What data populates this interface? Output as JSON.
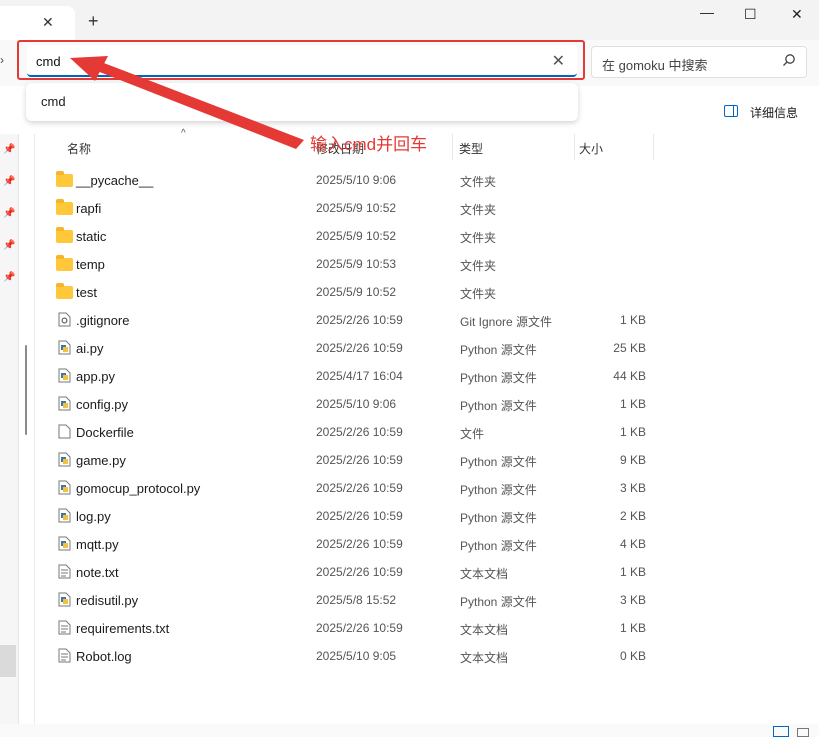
{
  "window": {
    "close_tab_glyph": "✕",
    "new_tab_glyph": "+",
    "minimize_glyph": "—",
    "maximize_glyph": "☐",
    "close_glyph": "✕"
  },
  "address": {
    "value": "cmd",
    "clear_glyph": "✕"
  },
  "search": {
    "placeholder": "在 gomoku 中搜索"
  },
  "suggestion": {
    "item": "cmd"
  },
  "toolbar": {
    "details_label": "详细信息"
  },
  "annotation": {
    "text": "输入cmd并回车",
    "color": "#e53935"
  },
  "columns": {
    "name": "名称",
    "date": "修改日期",
    "type": "类型",
    "size": "大小"
  },
  "files": [
    {
      "name": "__pycache__",
      "date": "2025/5/10 9:06",
      "type": "文件夹",
      "size": "",
      "icon": "folder-icon"
    },
    {
      "name": "rapfi",
      "date": "2025/5/9 10:52",
      "type": "文件夹",
      "size": "",
      "icon": "folder-icon"
    },
    {
      "name": "static",
      "date": "2025/5/9 10:52",
      "type": "文件夹",
      "size": "",
      "icon": "folder-icon"
    },
    {
      "name": "temp",
      "date": "2025/5/9 10:53",
      "type": "文件夹",
      "size": "",
      "icon": "folder-icon"
    },
    {
      "name": "test",
      "date": "2025/5/9 10:52",
      "type": "文件夹",
      "size": "",
      "icon": "folder-icon"
    },
    {
      "name": ".gitignore",
      "date": "2025/2/26 10:59",
      "type": "Git Ignore 源文件",
      "size": "1 KB",
      "icon": "gear-file-icon"
    },
    {
      "name": "ai.py",
      "date": "2025/2/26 10:59",
      "type": "Python 源文件",
      "size": "25 KB",
      "icon": "python-file-icon"
    },
    {
      "name": "app.py",
      "date": "2025/4/17 16:04",
      "type": "Python 源文件",
      "size": "44 KB",
      "icon": "python-file-icon"
    },
    {
      "name": "config.py",
      "date": "2025/5/10 9:06",
      "type": "Python 源文件",
      "size": "1 KB",
      "icon": "python-file-icon"
    },
    {
      "name": "Dockerfile",
      "date": "2025/2/26 10:59",
      "type": "文件",
      "size": "1 KB",
      "icon": "blank-file-icon"
    },
    {
      "name": "game.py",
      "date": "2025/2/26 10:59",
      "type": "Python 源文件",
      "size": "9 KB",
      "icon": "python-file-icon"
    },
    {
      "name": "gomocup_protocol.py",
      "date": "2025/2/26 10:59",
      "type": "Python 源文件",
      "size": "3 KB",
      "icon": "python-file-icon"
    },
    {
      "name": "log.py",
      "date": "2025/2/26 10:59",
      "type": "Python 源文件",
      "size": "2 KB",
      "icon": "python-file-icon"
    },
    {
      "name": "mqtt.py",
      "date": "2025/2/26 10:59",
      "type": "Python 源文件",
      "size": "4 KB",
      "icon": "python-file-icon"
    },
    {
      "name": "note.txt",
      "date": "2025/2/26 10:59",
      "type": "文本文档",
      "size": "1 KB",
      "icon": "text-file-icon"
    },
    {
      "name": "redisutil.py",
      "date": "2025/5/8 15:52",
      "type": "Python 源文件",
      "size": "3 KB",
      "icon": "python-file-icon"
    },
    {
      "name": "requirements.txt",
      "date": "2025/2/26 10:59",
      "type": "文本文档",
      "size": "1 KB",
      "icon": "text-file-icon"
    },
    {
      "name": "Robot.log",
      "date": "2025/5/10 9:05",
      "type": "文本文档",
      "size": "0 KB",
      "icon": "text-file-icon"
    }
  ]
}
